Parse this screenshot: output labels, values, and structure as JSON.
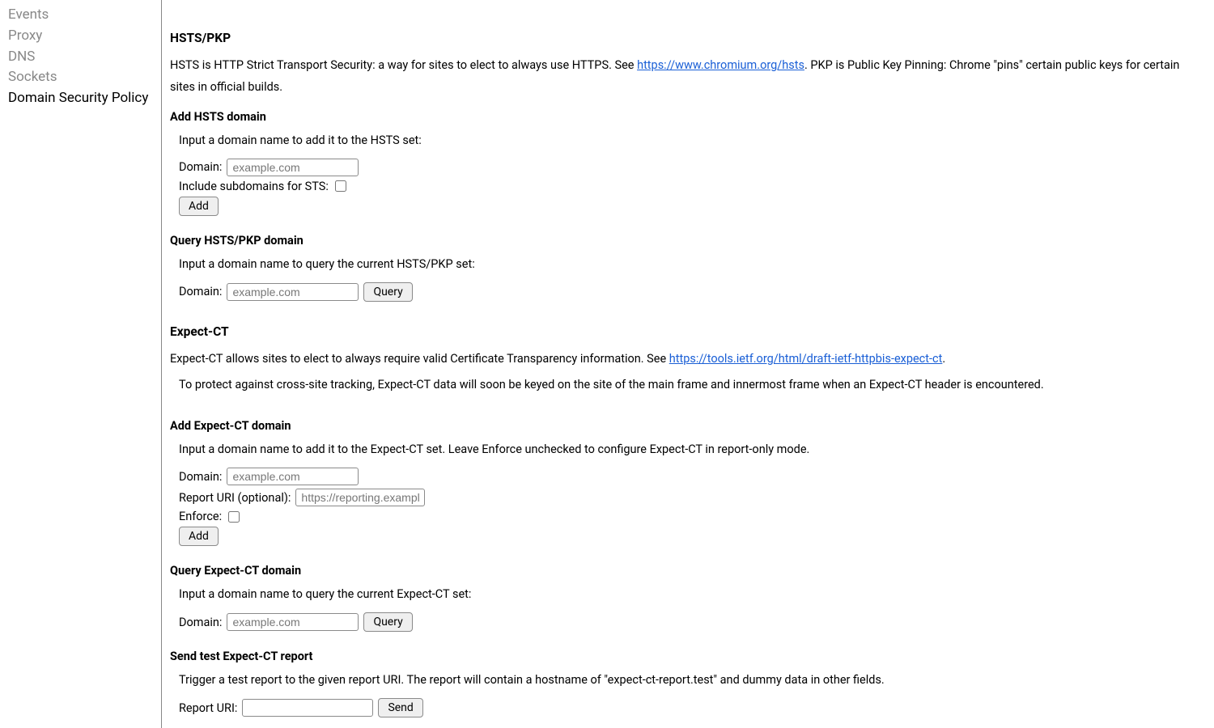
{
  "sidebar": {
    "items": [
      {
        "label": "Events"
      },
      {
        "label": "Proxy"
      },
      {
        "label": "DNS"
      },
      {
        "label": "Sockets"
      },
      {
        "label": "Domain Security Policy",
        "active": true
      }
    ]
  },
  "hsts": {
    "title": "HSTS/PKP",
    "intro_prefix": "HSTS is HTTP Strict Transport Security: a way for sites to elect to always use HTTPS. See ",
    "intro_link": "https://www.chromium.org/hsts",
    "intro_suffix": ". PKP is Public Key Pinning: Chrome \"pins\" certain public keys for certain sites in official builds.",
    "add_heading": "Add HSTS domain",
    "add_instr": "Input a domain name to add it to the HSTS set:",
    "domain_label": "Domain:",
    "domain_placeholder": "example.com",
    "include_subdomains_label": "Include subdomains for STS:",
    "add_button": "Add",
    "query_heading": "Query HSTS/PKP domain",
    "query_instr": "Input a domain name to query the current HSTS/PKP set:",
    "query_button": "Query"
  },
  "expect_ct": {
    "title": "Expect-CT",
    "intro_prefix": "Expect-CT allows sites to elect to always require valid Certificate Transparency information. See ",
    "intro_link": "https://tools.ietf.org/html/draft-ietf-httpbis-expect-ct",
    "intro_suffix": ".",
    "warning": "To protect against cross-site tracking, Expect-CT data will soon be keyed on the site of the main frame and innermost frame when an Expect-CT header is encountered.",
    "add_heading": "Add Expect-CT domain",
    "add_instr": "Input a domain name to add it to the Expect-CT set. Leave Enforce unchecked to configure Expect-CT in report-only mode.",
    "domain_label": "Domain:",
    "domain_placeholder": "example.com",
    "report_uri_label": "Report URI (optional):",
    "report_uri_placeholder": "https://reporting.example",
    "enforce_label": "Enforce:",
    "add_button": "Add",
    "query_heading": "Query Expect-CT domain",
    "query_instr": "Input a domain name to query the current Expect-CT set:",
    "query_button": "Query",
    "send_heading": "Send test Expect-CT report",
    "send_instr": "Trigger a test report to the given report URI. The report will contain a hostname of \"expect-ct-report.test\" and dummy data in other fields.",
    "send_report_label": "Report URI:",
    "send_button": "Send"
  }
}
